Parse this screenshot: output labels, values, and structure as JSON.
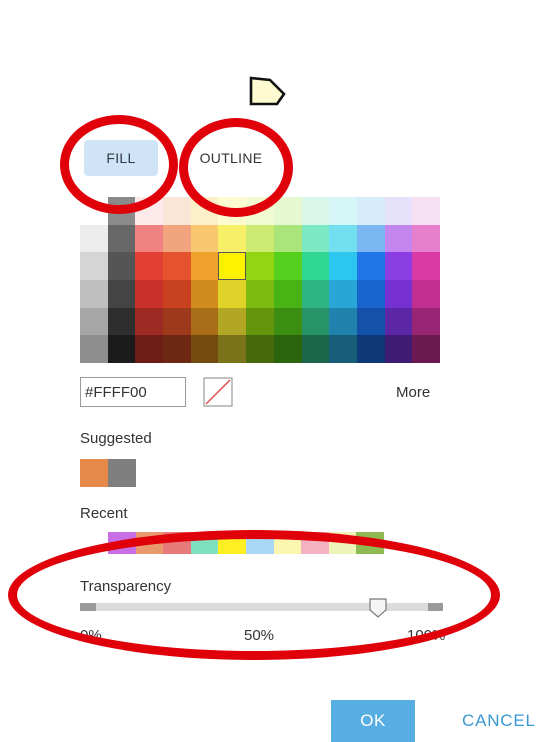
{
  "tabs": {
    "fill_label": "FILL",
    "outline_label": "OUTLINE"
  },
  "palette": {
    "rows": [
      [
        "#ffffff",
        "#8a8a8a",
        "#fde9e9",
        "#fbe5d6",
        "#fdf0c8",
        "#fffbd1",
        "#f2fad2",
        "#e6f8d2",
        "#d8f7e8",
        "#d6f5f7",
        "#d6ecfb",
        "#e7e2fb",
        "#f6e0f2"
      ],
      [
        "#ececec",
        "#676767",
        "#f08282",
        "#f2a47e",
        "#f8c76f",
        "#f7ef68",
        "#cdeb72",
        "#a9e57a",
        "#7ce8c4",
        "#72dff0",
        "#7ab7f2",
        "#c286ee",
        "#e67fcc"
      ],
      [
        "#d5d5d5",
        "#555555",
        "#e23f34",
        "#e4532e",
        "#f0a32c",
        "#fff200",
        "#94d512",
        "#55ce1e",
        "#30d793",
        "#2dc6ee",
        "#1e76e8",
        "#8a3ee3",
        "#d93aa6"
      ],
      [
        "#bfbfbf",
        "#444444",
        "#c93029",
        "#c9421f",
        "#d28b1f",
        "#dfd32a",
        "#7dbb10",
        "#47b314",
        "#2fb583",
        "#28a6d6",
        "#1964cd",
        "#762fd0",
        "#c22d90"
      ],
      [
        "#a6a6a6",
        "#2e2e2e",
        "#9e2a23",
        "#9d3a1c",
        "#a86d17",
        "#b1a725",
        "#64960d",
        "#3b8e12",
        "#289269",
        "#2083ad",
        "#1352a8",
        "#5c27a6",
        "#972574"
      ],
      [
        "#8e8e8e",
        "#1b1b1b",
        "#6f1c17",
        "#6d2814",
        "#754b10",
        "#7b7319",
        "#466909",
        "#2a640c",
        "#1c664a",
        "#175d7a",
        "#0d3a76",
        "#401b74",
        "#6a1a51"
      ]
    ],
    "selected_row": 2,
    "selected_col": 5
  },
  "hex_value": "#FFFF00",
  "no_color_icon": "no-color-slash-icon",
  "more_label": "More",
  "suggested": {
    "label": "Suggested",
    "colors": [
      "#e68a4b",
      "#7f7f7f"
    ]
  },
  "recent": {
    "label": "Recent",
    "colors": [
      "#c86ee6",
      "#e89a6e",
      "#e77a7a",
      "#7fe0c0",
      "#ffef22",
      "#a8d8f5",
      "#fbf6b0",
      "#f3b2c1",
      "#ecf4b8",
      "#8fba52"
    ]
  },
  "transparency": {
    "label": "Transparency",
    "value_fraction": 0.82,
    "min_label": "0%",
    "mid_label": "50%",
    "max_label": "100%"
  },
  "buttons": {
    "ok_label": "OK",
    "cancel_label": "CANCEL"
  },
  "colors": {
    "accent": "#58aee3",
    "annotation": "#e0000a",
    "tab_active_bg": "#cfe4f7"
  }
}
